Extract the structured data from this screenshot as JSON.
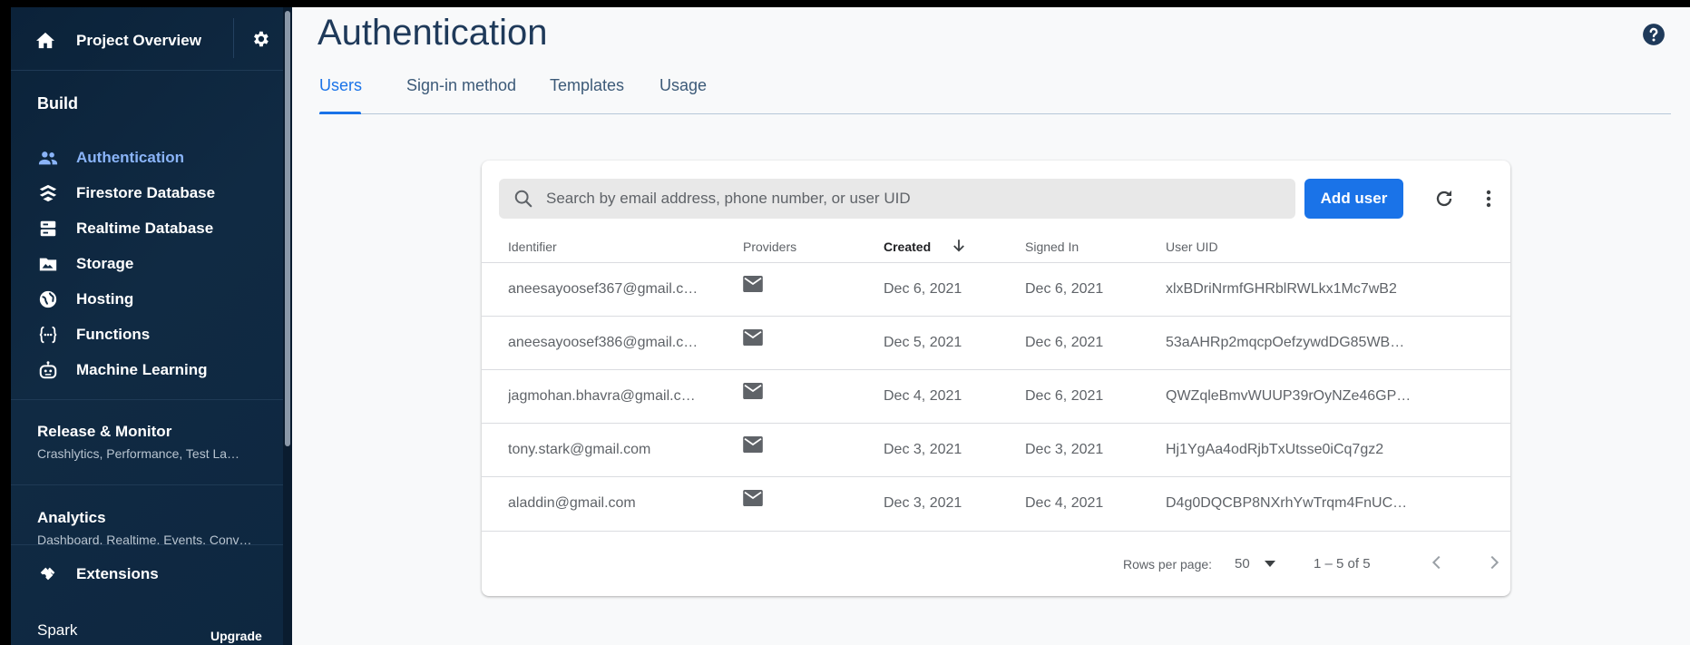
{
  "sidebar": {
    "project_title": "Project Overview",
    "build_heading": "Build",
    "items": [
      {
        "label": "Authentication",
        "icon": "people-icon",
        "active": true
      },
      {
        "label": "Firestore Database",
        "icon": "firestore-icon"
      },
      {
        "label": "Realtime Database",
        "icon": "database-icon"
      },
      {
        "label": "Storage",
        "icon": "storage-icon"
      },
      {
        "label": "Hosting",
        "icon": "globe-icon"
      },
      {
        "label": "Functions",
        "icon": "functions-icon"
      },
      {
        "label": "Machine Learning",
        "icon": "robot-icon"
      }
    ],
    "release_heading": "Release & Monitor",
    "release_sub": "Crashlytics, Performance, Test La…",
    "analytics_heading": "Analytics",
    "analytics_sub": "Dashboard, Realtime, Events, Conv…",
    "extensions_label": "Extensions",
    "plan_label": "Spark",
    "upgrade_label": "Upgrade"
  },
  "header": {
    "title": "Authentication",
    "tabs": [
      {
        "label": "Users",
        "active": true
      },
      {
        "label": "Sign-in method"
      },
      {
        "label": "Templates"
      },
      {
        "label": "Usage"
      }
    ]
  },
  "users": {
    "search_placeholder": "Search by email address, phone number, or user UID",
    "add_user_label": "Add user",
    "columns": [
      "Identifier",
      "Providers",
      "Created",
      "Signed In",
      "User UID"
    ],
    "rows": [
      {
        "identifier": "aneesayoosef367@gmail.c…",
        "created": "Dec 6, 2021",
        "signed_in": "Dec 6, 2021",
        "uid": "xlxBDriNrmfGHRblRWLkx1Mc7wB2"
      },
      {
        "identifier": "aneesayoosef386@gmail.c…",
        "created": "Dec 5, 2021",
        "signed_in": "Dec 6, 2021",
        "uid": "53aAHRp2mqcpOefzywdDG85WB…"
      },
      {
        "identifier": "jagmohan.bhavra@gmail.c…",
        "created": "Dec 4, 2021",
        "signed_in": "Dec 6, 2021",
        "uid": "QWZqleBmvWUUP39rOyNZe46GP…"
      },
      {
        "identifier": "tony.stark@gmail.com",
        "created": "Dec 3, 2021",
        "signed_in": "Dec 3, 2021",
        "uid": "Hj1YgAa4odRjbTxUtsse0iCq7gz2"
      },
      {
        "identifier": "aladdin@gmail.com",
        "created": "Dec 3, 2021",
        "signed_in": "Dec 4, 2021",
        "uid": "D4g0DQCBP8NXrhYwTrqm4FnUC…"
      }
    ],
    "rows_per_page_label": "Rows per page:",
    "rows_per_page_value": "50",
    "range_text": "1 – 5 of 5"
  },
  "colors": {
    "accent": "#1a73e8",
    "sidebar_bg": "#102a43",
    "active_nav": "#8ab4f8",
    "title": "#1f3a5a"
  }
}
